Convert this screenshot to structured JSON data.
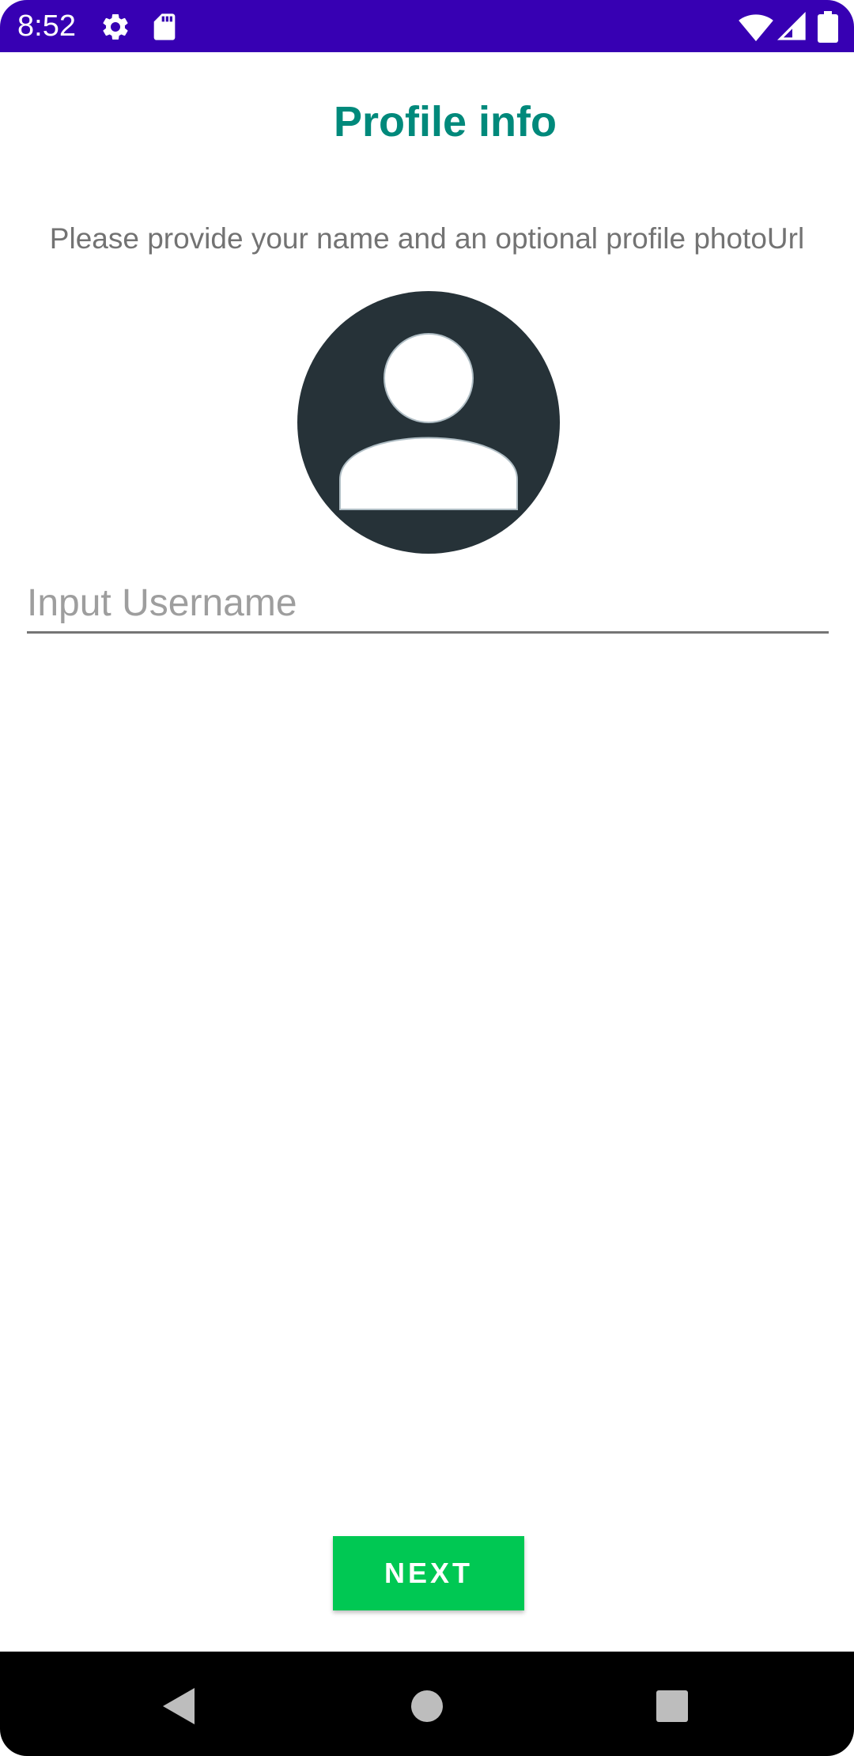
{
  "status_bar": {
    "time": "8:52",
    "icons": [
      "settings-icon",
      "sd-card-icon",
      "wifi-icon",
      "signal-icon",
      "battery-icon"
    ],
    "background": "#3700b3"
  },
  "screen": {
    "title": "Profile info",
    "subtitle": "Please provide your name and an optional profile photoUrl",
    "title_color": "#00897b"
  },
  "avatar": {
    "icon": "person-avatar-icon",
    "background": "#263238"
  },
  "username_field": {
    "value": "",
    "placeholder": "Input Username"
  },
  "next_button": {
    "label": "NEXT",
    "color": "#00c853"
  },
  "nav_bar": {
    "buttons": [
      "back-icon",
      "home-icon",
      "recents-icon"
    ]
  }
}
